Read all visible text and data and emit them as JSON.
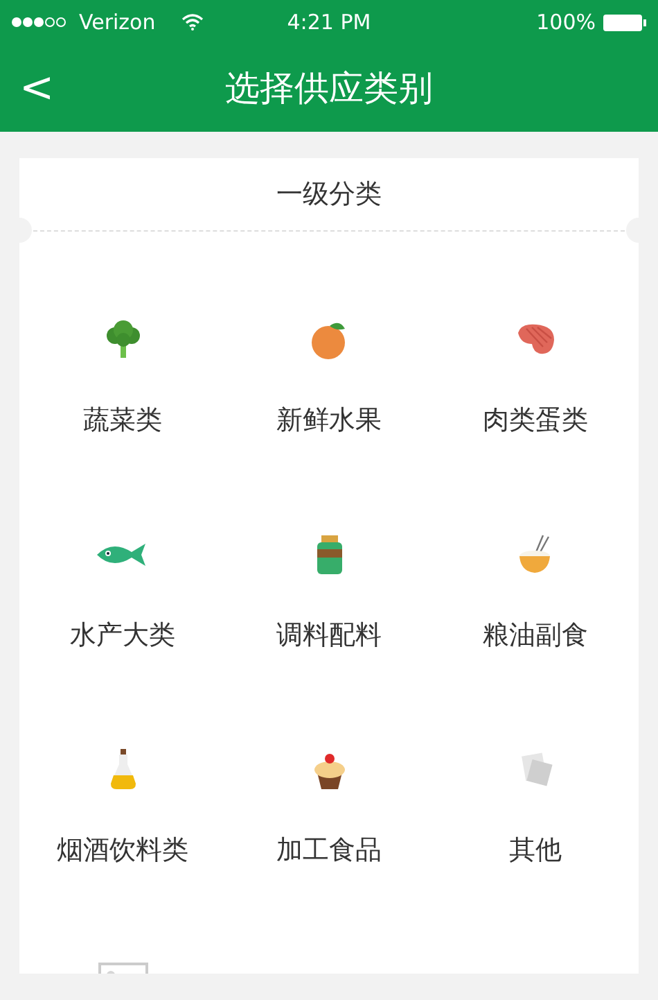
{
  "status_bar": {
    "carrier": "Verizon",
    "time": "4:21 PM",
    "battery": "100%"
  },
  "nav_bar": {
    "back": "<",
    "title": "选择供应类别"
  },
  "section": {
    "title": "一级分类"
  },
  "categories": [
    {
      "kind": "broccoli",
      "label": "蔬菜类"
    },
    {
      "kind": "orange",
      "label": "新鲜水果"
    },
    {
      "kind": "steak",
      "label": "肉类蛋类"
    },
    {
      "kind": "fish",
      "label": "水产大类"
    },
    {
      "kind": "sauce",
      "label": "调料配料"
    },
    {
      "kind": "rice",
      "label": "粮油副食"
    },
    {
      "kind": "oil",
      "label": "烟酒饮料类"
    },
    {
      "kind": "cupcake",
      "label": "加工食品"
    },
    {
      "kind": "paper",
      "label": "其他"
    },
    {
      "kind": "placeholder"
    }
  ]
}
